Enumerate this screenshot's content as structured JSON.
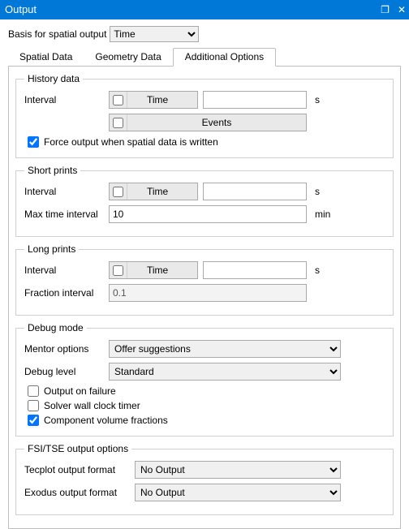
{
  "window": {
    "title": "Output"
  },
  "basis": {
    "label": "Basis for spatial output",
    "value": "Time"
  },
  "tabs": {
    "spatial": "Spatial Data",
    "geometry": "Geometry Data",
    "additional": "Additional Options"
  },
  "history": {
    "legend": "History data",
    "interval_label": "Interval",
    "time_btn": "Time",
    "time_value": "",
    "time_unit": "s",
    "events_btn": "Events",
    "force_label": "Force output when spatial data is written"
  },
  "short": {
    "legend": "Short prints",
    "interval_label": "Interval",
    "time_btn": "Time",
    "time_value": "",
    "time_unit": "s",
    "max_label": "Max time interval",
    "max_value": "10",
    "max_unit": "min"
  },
  "long": {
    "legend": "Long prints",
    "interval_label": "Interval",
    "time_btn": "Time",
    "time_value": "",
    "time_unit": "s",
    "fraction_label": "Fraction interval",
    "fraction_value": "0.1"
  },
  "debug": {
    "legend": "Debug mode",
    "mentor_label": "Mentor options",
    "mentor_value": "Offer suggestions",
    "level_label": "Debug level",
    "level_value": "Standard",
    "out_fail": "Output on failure",
    "solver_clock": "Solver wall clock timer",
    "comp_vol": "Component volume fractions"
  },
  "fsi": {
    "legend": "FSI/TSE output options",
    "tecplot_label": "Tecplot output format",
    "tecplot_value": "No Output",
    "exodus_label": "Exodus output format",
    "exodus_value": "No Output"
  }
}
